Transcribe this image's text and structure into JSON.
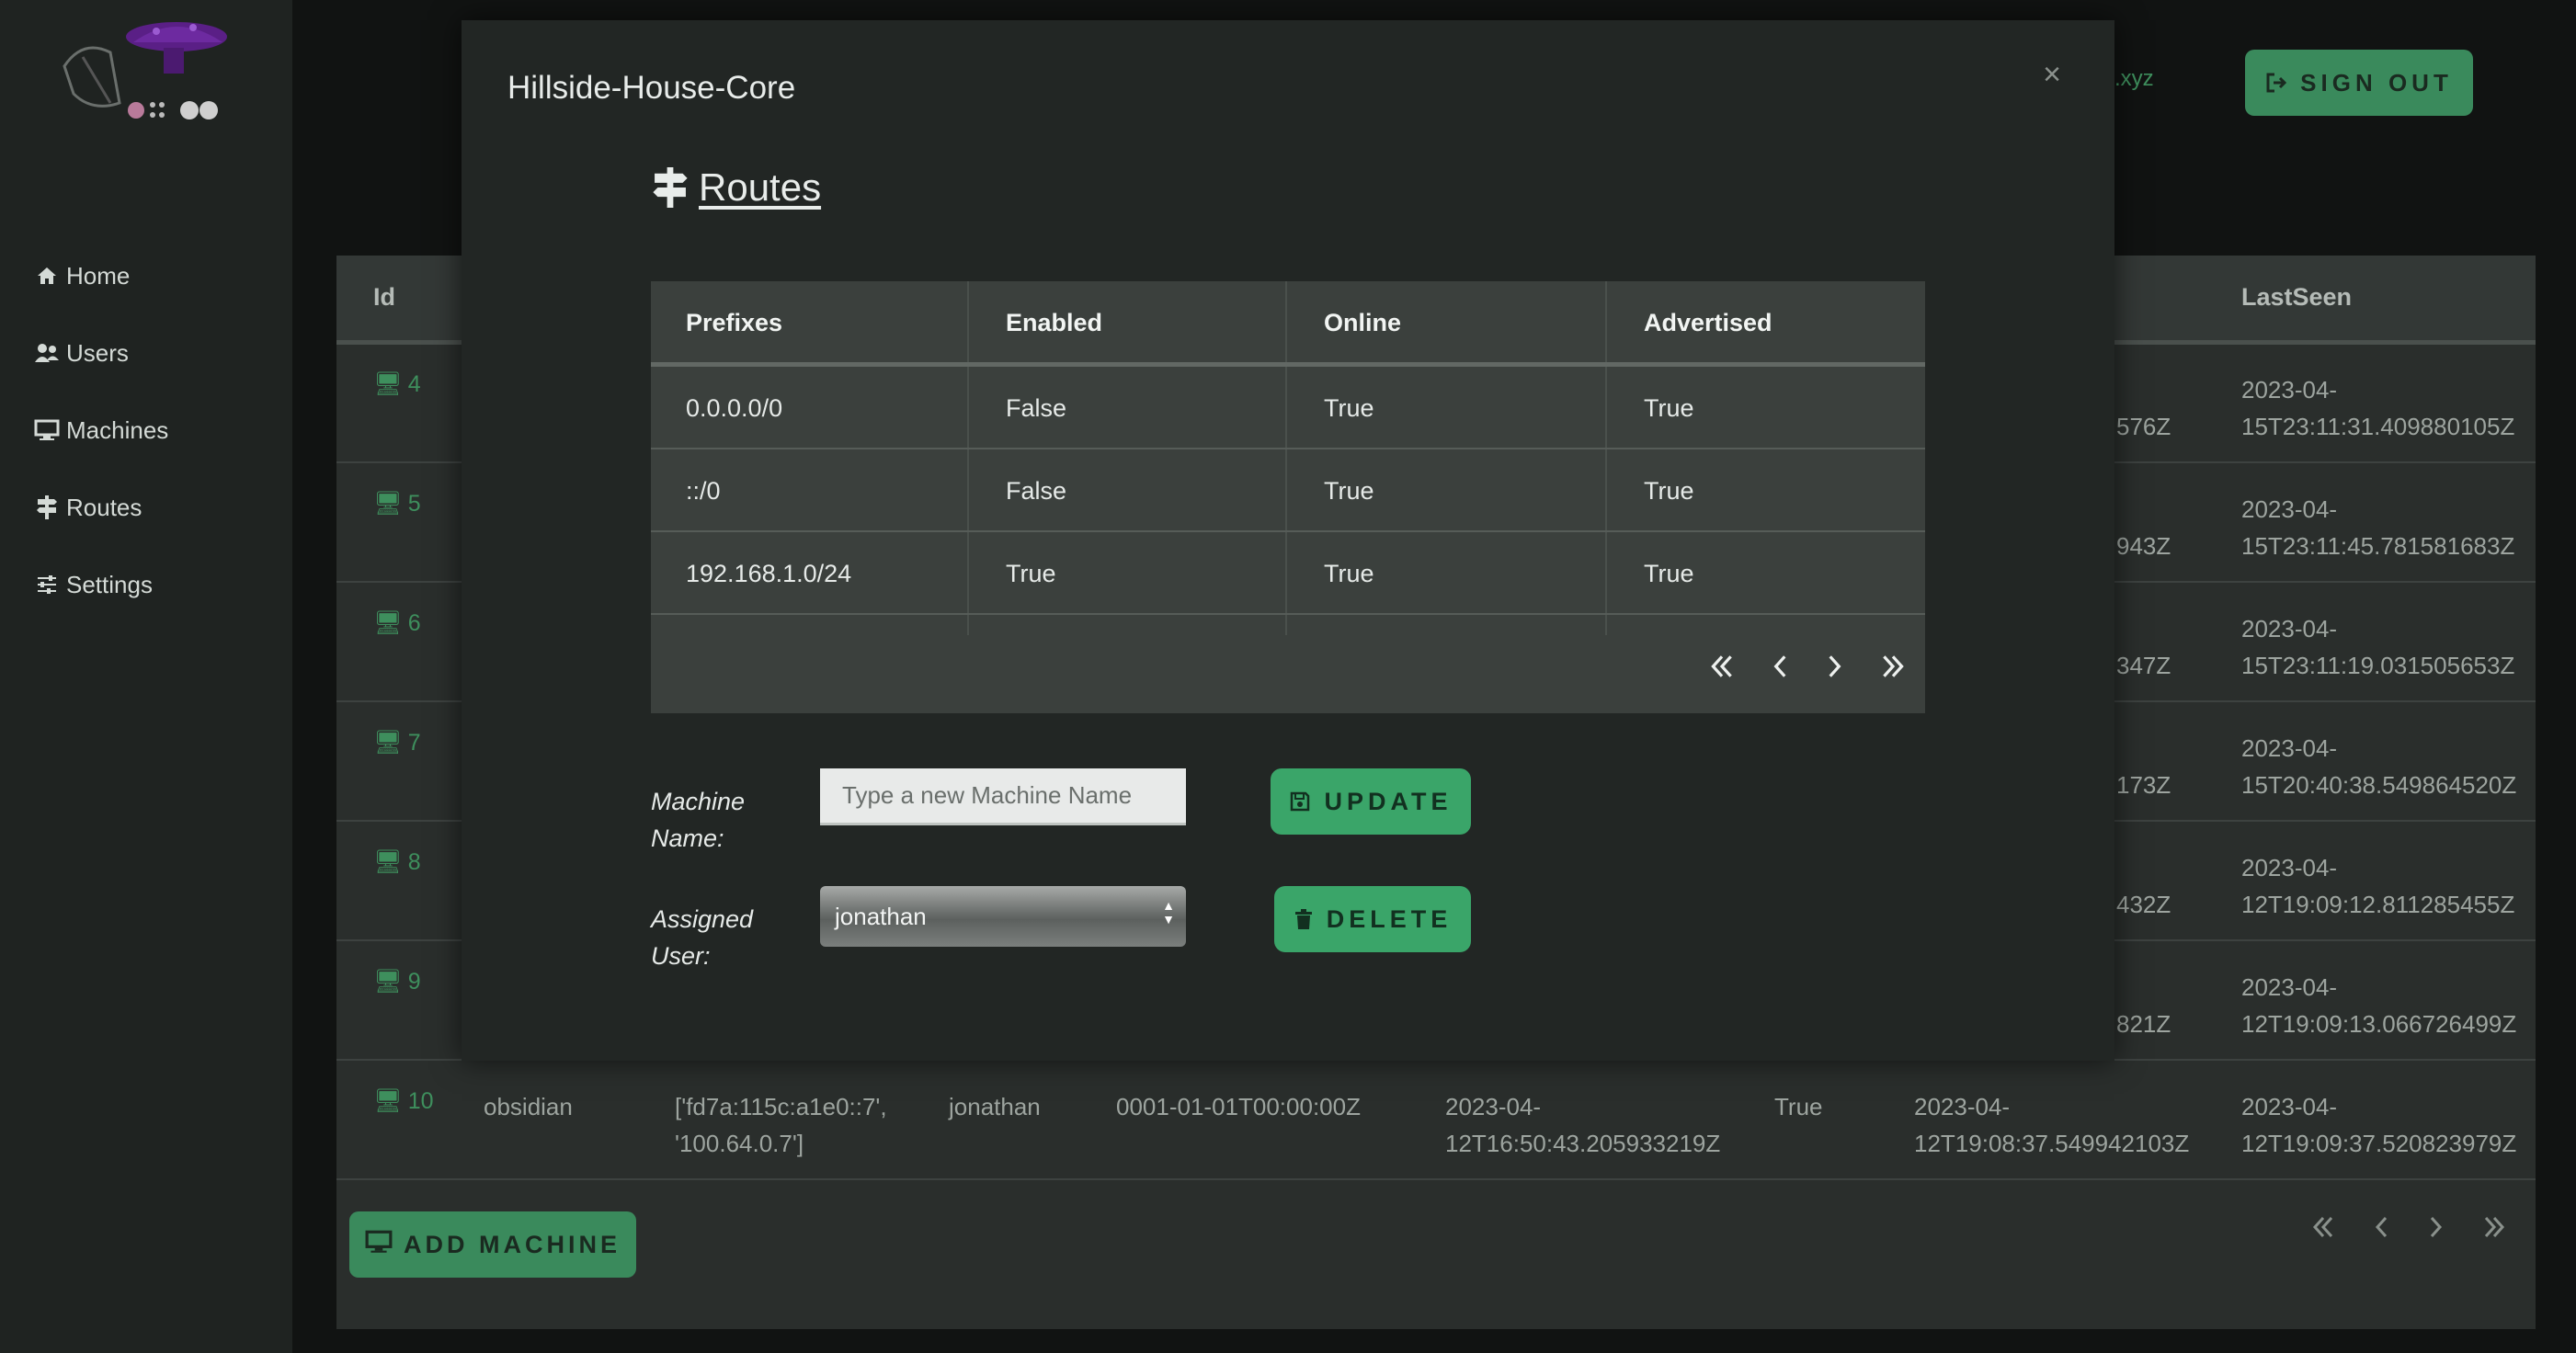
{
  "nav": {
    "items": [
      {
        "label": "Home",
        "icon": "home-icon"
      },
      {
        "label": "Users",
        "icon": "users-icon"
      },
      {
        "label": "Machines",
        "icon": "desktop-icon"
      },
      {
        "label": "Routes",
        "icon": "signpost-icon"
      },
      {
        "label": "Settings",
        "icon": "sliders-icon"
      }
    ]
  },
  "topbar": {
    "user_suffix": ".xyz",
    "signout_label": "SIGN OUT"
  },
  "machines_table": {
    "headers": {
      "id": "Id",
      "lastseen": "LastSeen"
    },
    "rows": [
      {
        "id": "4",
        "col_partial": "576Z",
        "lastseen": "2023-04-15T23:11:31.409880105Z"
      },
      {
        "id": "5",
        "col_partial": "943Z",
        "lastseen": "2023-04-15T23:11:45.781581683Z"
      },
      {
        "id": "6",
        "col_partial": "347Z",
        "lastseen": "2023-04-15T23:11:19.031505653Z"
      },
      {
        "id": "7",
        "col_partial": "173Z",
        "lastseen": "2023-04-15T20:40:38.549864520Z"
      },
      {
        "id": "8",
        "col_partial": "432Z",
        "lastseen": "2023-04-12T19:09:12.811285455Z"
      },
      {
        "id": "9",
        "col_partial": "821Z",
        "lastseen": "2023-04-12T19:09:13.066726499Z"
      }
    ],
    "last_row": {
      "id": "10",
      "name": "obsidian",
      "ips": "['fd7a:115c:a1e0::7', '100.64.0.7']",
      "user": "jonathan",
      "expiry": "0001-01-01T00:00:00Z",
      "created": "2023-04-12T16:50:43.205933219Z",
      "online": "True",
      "updated": "2023-04-12T19:08:37.549942103Z",
      "lastseen": "2023-04-12T19:09:37.520823979Z"
    },
    "add_machine_label": "ADD MACHINE"
  },
  "modal": {
    "title": "Hillside-House-Core",
    "close": "×",
    "routes_heading": "Routes",
    "routes": {
      "headers": [
        "Prefixes",
        "Enabled",
        "Online",
        "Advertised"
      ],
      "rows": [
        [
          "0.0.0.0/0",
          "False",
          "True",
          "True"
        ],
        [
          "::/0",
          "False",
          "True",
          "True"
        ],
        [
          "192.168.1.0/24",
          "True",
          "True",
          "True"
        ]
      ]
    },
    "machine_name_label": "Machine Name:",
    "machine_name_placeholder": "Type a new Machine Name",
    "assigned_user_label": "Assigned User:",
    "assigned_user_value": "jonathan",
    "update_label": "UPDATE",
    "delete_label": "DELETE"
  },
  "colors": {
    "accent": "#3aa569",
    "accent_dark": "#3a8a5c",
    "id_link": "#3e8f5d"
  }
}
